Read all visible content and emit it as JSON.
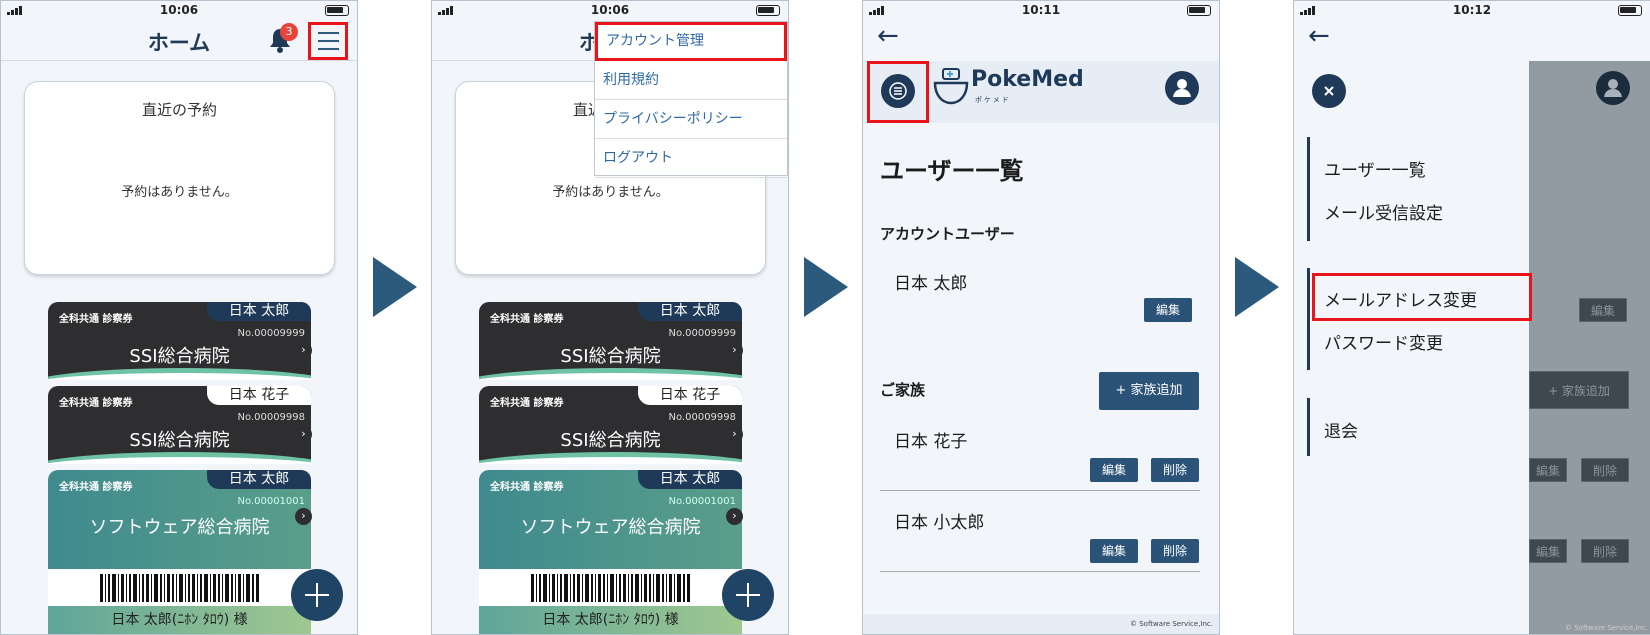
{
  "screen1": {
    "status_time": "10:06",
    "title": "ホーム",
    "notification_count": "3",
    "recent": {
      "title": "直近の予約",
      "message": "予約はありません。"
    },
    "cards": [
      {
        "type": "全科共通 診察券",
        "name": "日本 太郎",
        "number": "No.00009999",
        "hospital": "SSI総合病院"
      },
      {
        "type": "全科共通 診察券",
        "name": "日本 花子",
        "number": "No.00009998",
        "hospital": "SSI総合病院"
      },
      {
        "type": "全科共通 診察券",
        "name": "日本 太郎",
        "number": "No.00001001",
        "hospital": "ソフトウェア総合病院"
      }
    ],
    "patient_label": "日本 太郎(ﾆﾎﾝ ﾀﾛｳ) 様"
  },
  "screen2": {
    "status_time": "10:06",
    "menu": [
      "アカウント管理",
      "利用規約",
      "プライバシーポリシー",
      "ログアウト"
    ]
  },
  "screen3": {
    "status_time": "10:11",
    "logo": "PokeMed",
    "logo_sub": "ポケメド",
    "heading": "ユーザー一覧",
    "account_section": "アカウントユーザー",
    "account_user": "日本 太郎",
    "edit_label": "編集",
    "delete_label": "削除",
    "family_section": "ご家族",
    "add_family_label": "+ 家族追加",
    "family": [
      "日本 花子",
      "日本 小太郎"
    ],
    "footer": "© Software Service,Inc."
  },
  "screen4": {
    "status_time": "10:12",
    "drawer": {
      "group1": [
        "ユーザー一覧",
        "メール受信設定"
      ],
      "group2": [
        "メールアドレス変更",
        "パスワード変更"
      ],
      "group3": [
        "退会"
      ]
    },
    "footer": "© Software Service,Inc."
  },
  "colors": {
    "primary": "#1f3a58",
    "highlight": "#e8141a",
    "accent_arrow": "#2b5a7c"
  }
}
